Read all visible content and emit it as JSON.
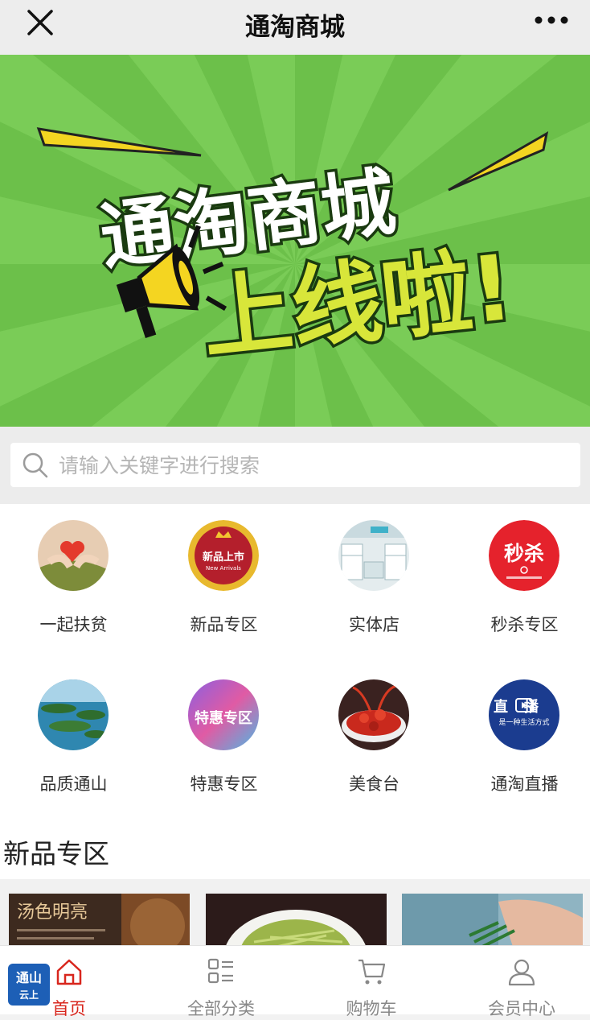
{
  "header": {
    "title": "通淘商城",
    "close_icon": "close-icon",
    "more_icon": "more-icon"
  },
  "banner": {
    "line1": "通淘商城",
    "line2": "上线啦!",
    "bg_color": "#6cc04a",
    "icon": "megaphone-icon"
  },
  "search": {
    "placeholder": "请输入关键字进行搜索",
    "value": ""
  },
  "categories": [
    {
      "label": "一起扶贫",
      "icon": "poverty-relief-icon"
    },
    {
      "label": "新品专区",
      "icon": "new-arrivals-icon",
      "badge_text": "新品上市",
      "badge_sub": "New Arrivals"
    },
    {
      "label": "实体店",
      "icon": "store-icon"
    },
    {
      "label": "秒杀专区",
      "icon": "flash-sale-icon",
      "badge_text": "秒杀"
    },
    {
      "label": "品质通山",
      "icon": "quality-tongshan-icon"
    },
    {
      "label": "特惠专区",
      "icon": "special-offer-icon",
      "badge_text": "特惠专区"
    },
    {
      "label": "美食台",
      "icon": "food-icon"
    },
    {
      "label": "通淘直播",
      "icon": "live-stream-icon",
      "badge_text": "直播",
      "badge_sub": "是一种生活方式"
    }
  ],
  "section": {
    "title": "新品专区"
  },
  "products": [
    {
      "caption": "汤色明亮",
      "icon": "tea-product-icon"
    },
    {
      "icon": "green-tea-bowl-icon"
    },
    {
      "icon": "tea-leaves-hand-icon"
    }
  ],
  "tabbar": {
    "app_logo": "通山",
    "app_logo_sub": "云上",
    "tabs": [
      {
        "label": "首页",
        "icon": "home-icon",
        "active": true
      },
      {
        "label": "全部分类",
        "icon": "category-icon",
        "active": false
      },
      {
        "label": "购物车",
        "icon": "cart-icon",
        "active": false
      },
      {
        "label": "会员中心",
        "icon": "user-icon",
        "active": false
      }
    ]
  },
  "colors": {
    "accent": "#d8261d",
    "banner_green": "#6cc04a",
    "title_yellow": "#d8e63a"
  }
}
